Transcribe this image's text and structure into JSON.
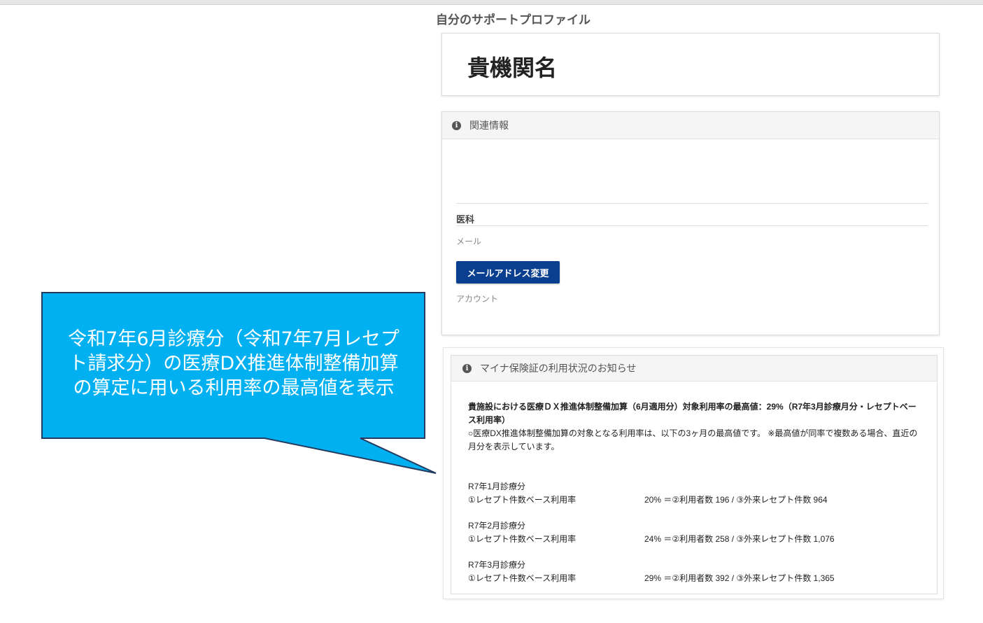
{
  "page": {
    "title": "自分のサポートプロファイル"
  },
  "org": {
    "name": "貴機関名"
  },
  "related": {
    "header": "関連情報",
    "department": "医科",
    "mail_label": "メール",
    "mail_button": "メールアドレス変更",
    "account_label": "アカウント"
  },
  "myna": {
    "header": "マイナ保険証の利用状況のお知らせ",
    "headline": "貴施設における医療ＤＸ推進体制整備加算（6月適用分）対象利用率の最高値：29%（R7年3月診療月分・レセプトベース利用率）",
    "note": "○医療DX推進体制整備加算の対象となる利用率は、以下の3ヶ月の最高値です。 ※最高値が同率で複数ある場合、直近の月分を表示しています。",
    "months": [
      {
        "title": "R7年1月診療分",
        "label": "①レセプト件数ベース利用率",
        "value": "20% ＝②利用者数 196 / ③外来レセプト件数 964"
      },
      {
        "title": "R7年2月診療分",
        "label": "①レセプト件数ベース利用率",
        "value": "24% ＝②利用者数 258 / ③外来レセプト件数 1,076"
      },
      {
        "title": "R7年3月診療分",
        "label": "①レセプト件数ベース利用率",
        "value": "29% ＝②利用者数 392 / ③外来レセプト件数 1,365"
      }
    ]
  },
  "callout": {
    "line1": "令和7年6月診療分（令和7年7月レセプ",
    "line2": "ト請求分）の医療DX推進体制整備加算",
    "line3": "の算定に用いる利用率の最高値を表示",
    "color": "#00b0f0"
  }
}
